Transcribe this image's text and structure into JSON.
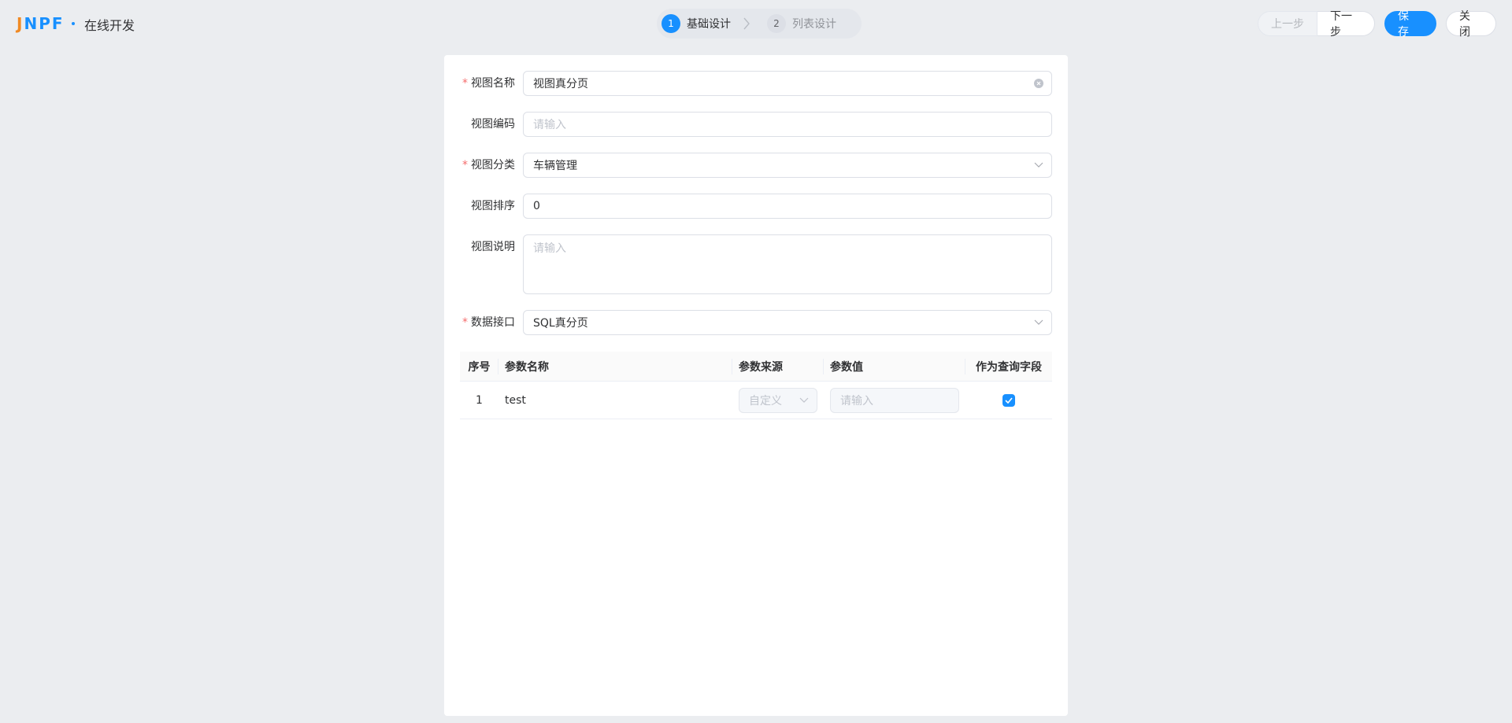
{
  "header": {
    "logo": "JNPF",
    "app_title": "在线开发",
    "steps": [
      {
        "num": "1",
        "label": "基础设计"
      },
      {
        "num": "2",
        "label": "列表设计"
      }
    ],
    "buttons": {
      "prev": "上一步",
      "next": "下一步",
      "save": "保 存",
      "close": "关 闭"
    }
  },
  "form": {
    "view_name": {
      "label": "视图名称",
      "required": true,
      "value": "视图真分页"
    },
    "view_code": {
      "label": "视图编码",
      "required": false,
      "placeholder": "请输入"
    },
    "view_category": {
      "label": "视图分类",
      "required": true,
      "value": "车辆管理"
    },
    "view_sort": {
      "label": "视图排序",
      "required": false,
      "value": "0"
    },
    "view_desc": {
      "label": "视图说明",
      "required": false,
      "placeholder": "请输入"
    },
    "data_api": {
      "label": "数据接口",
      "required": true,
      "value": "SQL真分页"
    }
  },
  "params_table": {
    "columns": [
      "序号",
      "参数名称",
      "参数来源",
      "参数值",
      "作为查询字段"
    ],
    "rows": [
      {
        "index": "1",
        "name": "test",
        "source": "自定义",
        "value_placeholder": "请输入",
        "as_query": true
      }
    ]
  },
  "colors": {
    "primary": "#1890ff",
    "required": "#f56c6c",
    "background": "#ebedf0"
  }
}
